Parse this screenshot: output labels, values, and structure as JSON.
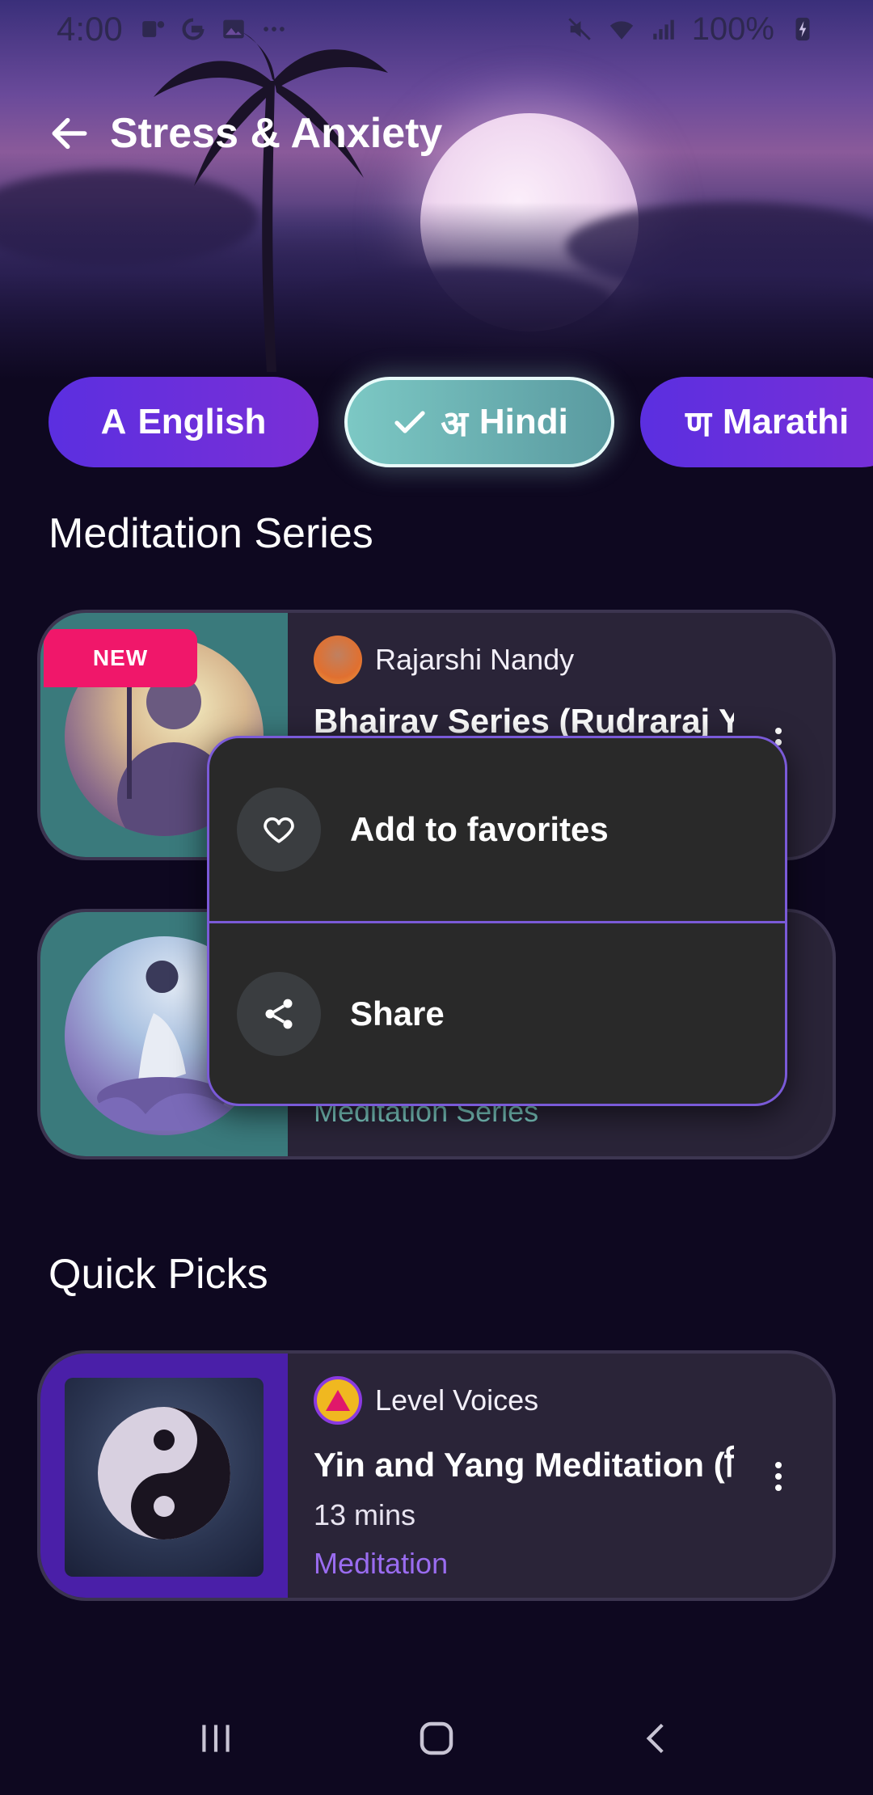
{
  "status_bar": {
    "time": "4:00",
    "battery": "100%",
    "icons": [
      "teams-icon",
      "google-icon",
      "gallery-icon",
      "more-dots-icon",
      "mute-icon",
      "wifi-icon",
      "signal-icon",
      "battery-charging-icon"
    ]
  },
  "header": {
    "title": "Stress & Anxiety",
    "back_icon": "arrow-left-icon"
  },
  "languages": [
    {
      "glyph": "A",
      "label": "English",
      "selected": false
    },
    {
      "glyph": "अ",
      "label": "Hindi",
      "selected": true
    },
    {
      "glyph": "ण",
      "label": "Marathi",
      "selected": false
    }
  ],
  "sections": {
    "series_title": "Meditation Series",
    "quick_title": "Quick Picks"
  },
  "series_cards": [
    {
      "badge": "NEW",
      "author": "Rajarshi Nandy",
      "title": "Bhairav Series (Rudraraj Yog",
      "tag": ""
    },
    {
      "author": "",
      "title": "",
      "tag": "Meditation Series"
    }
  ],
  "quick_cards": [
    {
      "author": "Level Voices",
      "title": "Yin and Yang Meditation (हि",
      "duration": "13 mins",
      "tag": "Meditation"
    }
  ],
  "popup_menu": {
    "items": [
      {
        "icon": "heart-icon",
        "label": "Add to favorites"
      },
      {
        "icon": "share-icon",
        "label": "Share"
      }
    ]
  },
  "colors": {
    "background": "#0e0820",
    "accent_purple": "#6a2fe0",
    "selected_teal": "#6fb8b6",
    "teal_text": "#7fd0c8",
    "purple_text": "#9a6cf0",
    "new_badge": "#f0176a",
    "menu_border": "#7a5ad8"
  }
}
